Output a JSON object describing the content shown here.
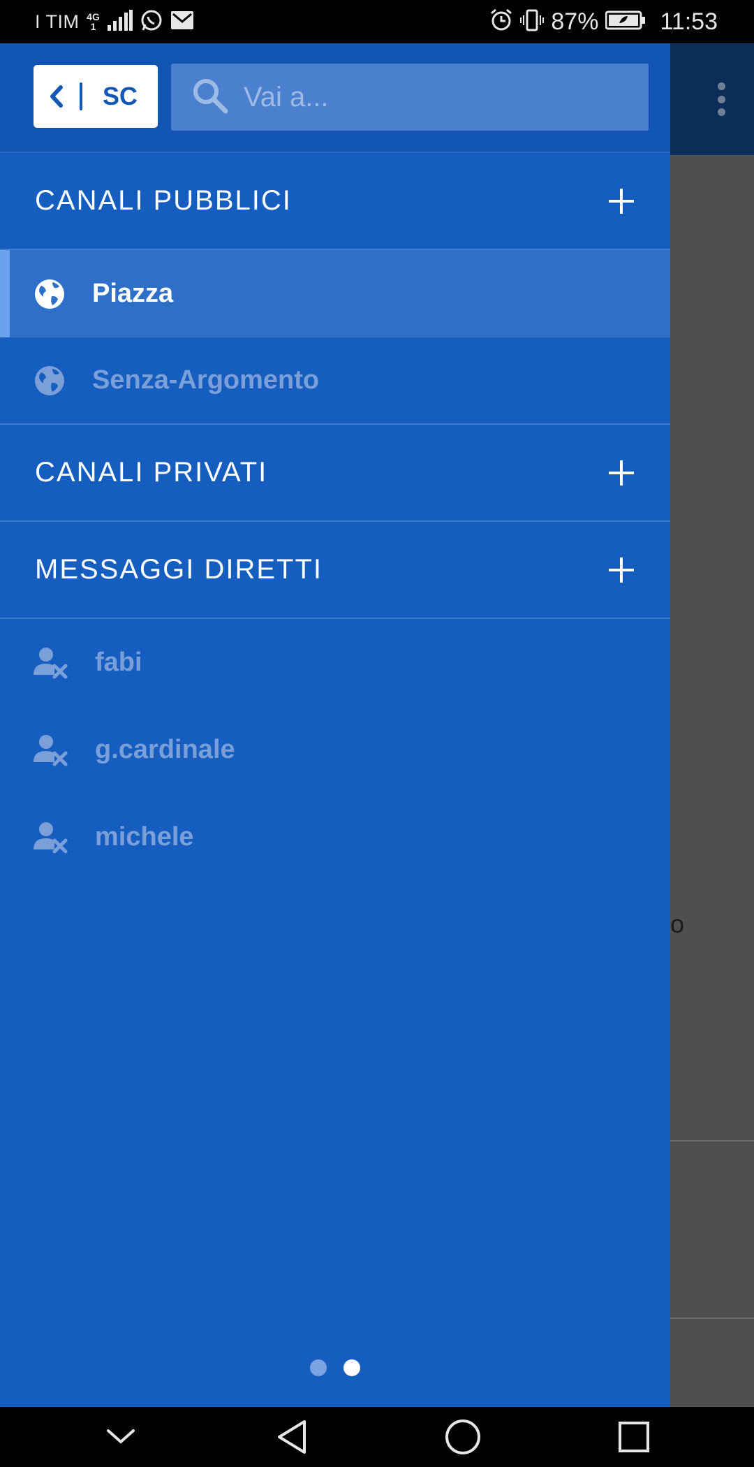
{
  "status_bar": {
    "carrier": "I TIM",
    "network_top": "4G",
    "network_bottom": "1",
    "battery_percent": "87%",
    "time": "11:53"
  },
  "drawer": {
    "back_label": "SC",
    "search": {
      "placeholder": "Vai a...",
      "value": ""
    },
    "sections": {
      "public": {
        "title": "CANALI PUBBLICI"
      },
      "private": {
        "title": "CANALI PRIVATI"
      },
      "direct": {
        "title": "MESSAGGI DIRETTI"
      }
    },
    "public_channels": [
      {
        "name": "Piazza",
        "active": true
      },
      {
        "name": "Senza-Argomento",
        "active": false
      }
    ],
    "direct_messages": [
      {
        "name": "fabi"
      },
      {
        "name": "g.cardinale"
      },
      {
        "name": "michele"
      }
    ],
    "pager": {
      "total": 2,
      "current": 2
    }
  },
  "background": {
    "peek_text": "o"
  },
  "colors": {
    "drawer_bg": "#155ec0",
    "active_row": "#2e70c8",
    "muted_text": "#7a9fd9",
    "header_bg": "#1255b2"
  }
}
